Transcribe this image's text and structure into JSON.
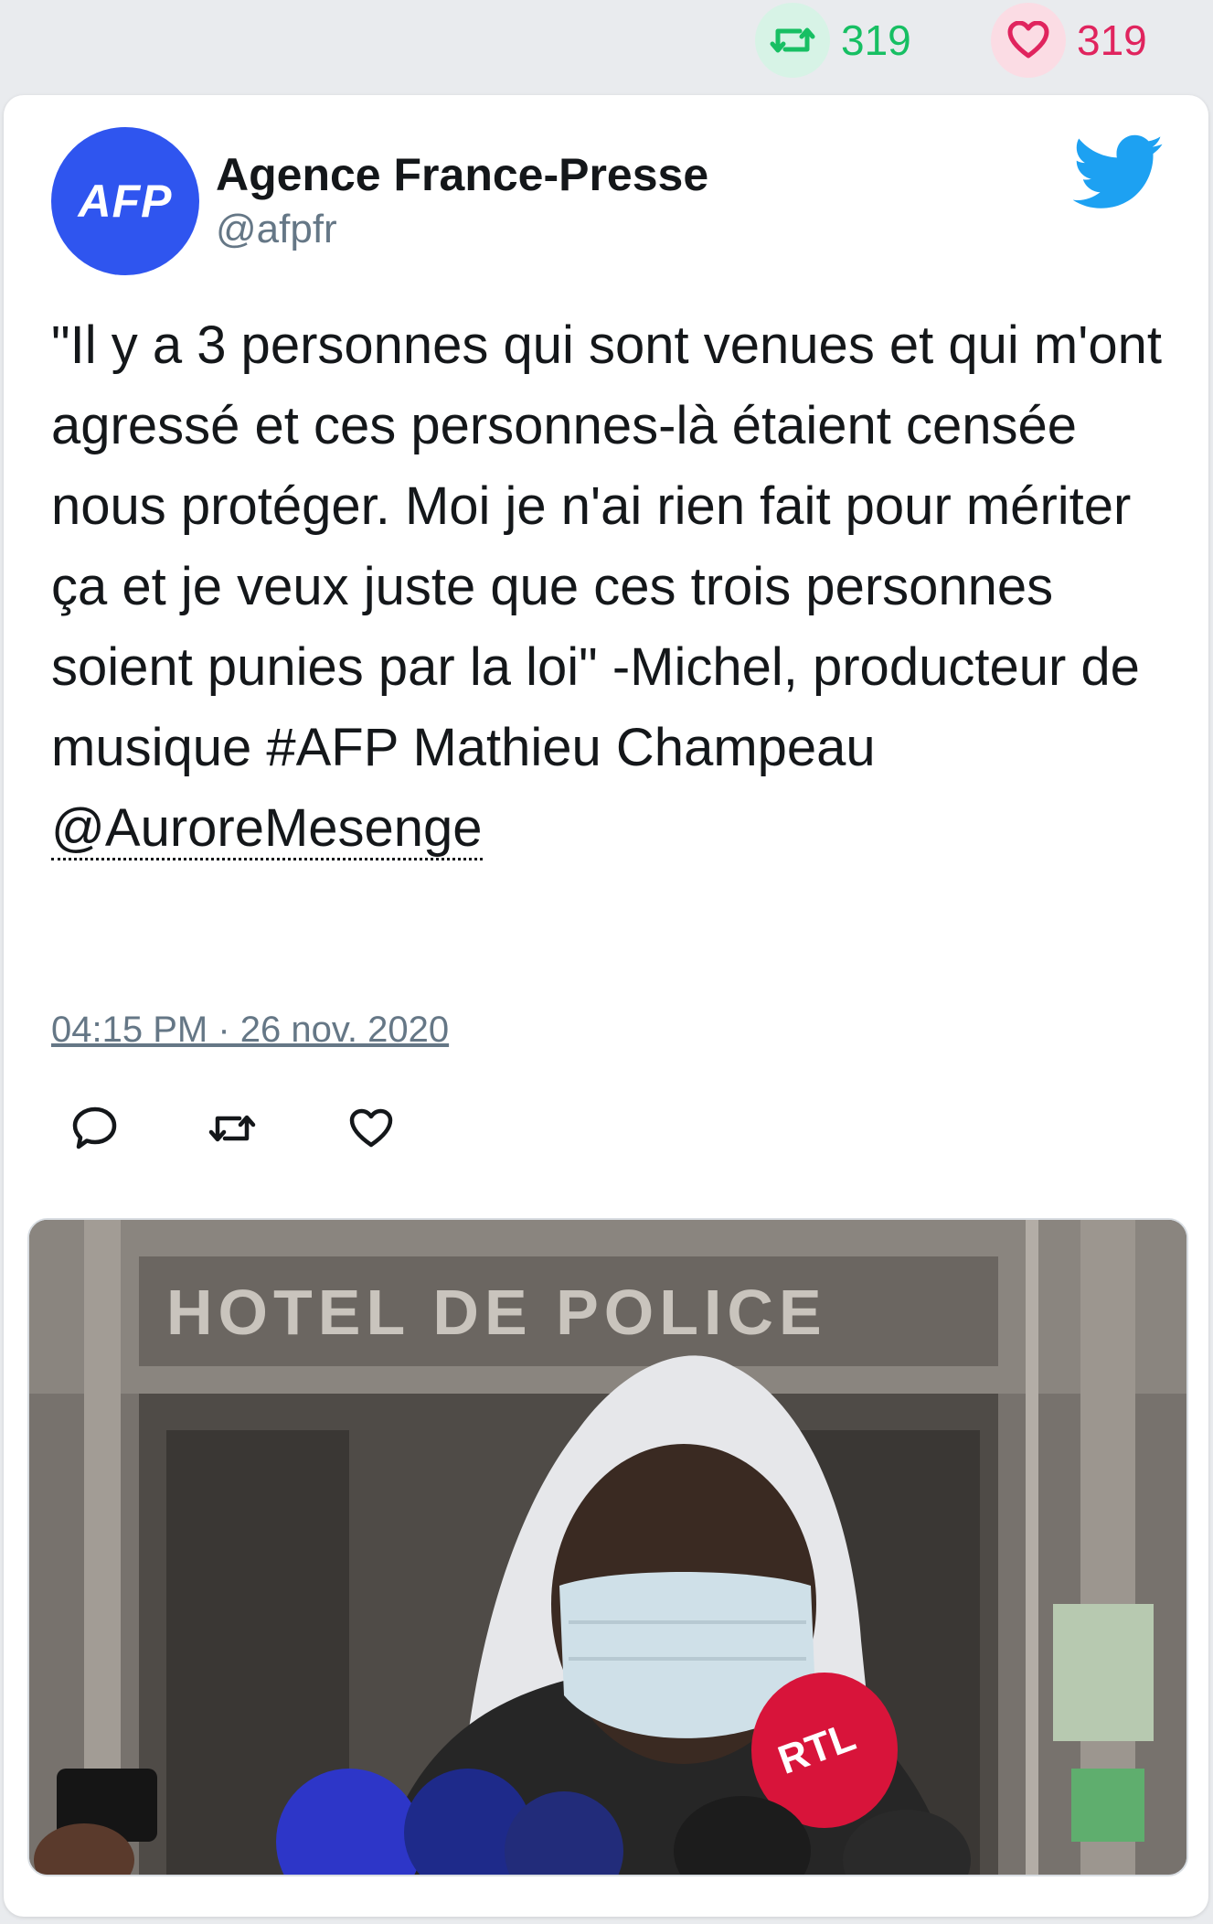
{
  "stats": {
    "retweets": "319",
    "likes": "319"
  },
  "tweet": {
    "author_name": "Agence France-Presse",
    "author_handle": "@afpfr",
    "avatar_text": "AFP",
    "text_main": "\"Il y a 3 personnes qui sont venues et qui m'ont agressé et ces personnes-là étaient censée nous protéger. Moi je n'ai rien fait pour mériter ça et je veux juste que ces trois personnes soient punies par la loi\" -Michel, producteur de musique #AFP Mathieu Champeau",
    "mention": "@AuroreMesenge",
    "timestamp": "04:15 PM · 26 nov. 2020"
  },
  "media": {
    "sign_text": "HOTEL DE POLICE",
    "mic_label": "RTL"
  },
  "colors": {
    "retweet": "#17bf63",
    "like": "#e0245e",
    "twitter_blue": "#1da1f2",
    "afp_blue": "#2f55ef"
  },
  "icons": [
    "retweet-icon",
    "heart-icon",
    "twitter-bird-icon",
    "reply-icon"
  ]
}
